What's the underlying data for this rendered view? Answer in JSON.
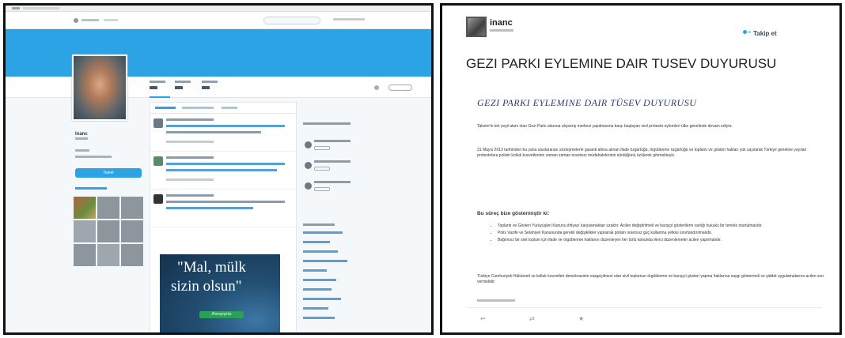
{
  "left": {
    "profile_name": "Inanc",
    "tweet_button": "Tweet",
    "promo_line1": "\"Mal, mülk",
    "promo_line2": "sizin olsun\"",
    "promo_tag": "#herşeyiniz"
  },
  "right": {
    "user_name": "inanc",
    "follow_label": "Takip et",
    "tweet_title": "GEZI PARKI EYLEMINE DAIR TUSEV DUYURUSU",
    "article_title": "GEZI PARKI EYLEMINE DAIR TÜSEV DUYURUSU",
    "paragraph1": "Taksim'in tek yeşil alanı olan Gezi Parkı alanına alışveriş merkezi yapılmasına karşı başlayan sivil protesto eylemleri ülke genelinde devam ediyor.",
    "paragraph2": "31 Mayıs 2013 tarihinden bu yana uluslararası sözleşmelerle garanti altına alınan ifade özgürlüğü, örgütlenme özgürlüğü ve toplantı ve gösteri hakları yok sayılarak Türkiye geneline yayılan protestolara polisin kolluk kuvvetlerinin zaman zaman orantısız müdahalelerinin sürdüğünü üzülerek görmekteyiz.",
    "subheading": "Bu süreç bize göstermiştir ki:",
    "list": [
      "Toplantı ve Gösteri Yürüyüşleri Kanunu ihtiyacı karşılamaktan uzaktır. Acilen değiştirilmeli ve barışçıl gösterilerin varlığı hukuku bir temele oturtulmalıdır.",
      "Polis Vazife ve Selahiyet Kanununda gerekli değişiklikler yapılarak polisin orantısız güç kullanma yetkisi sınırlandırılmalıdır.",
      "Bağımsız bir sivil toplum için ifade ve örgütlenme haklarını düzenleyen her türlü kanunda ilerici düzenlemeler acilen yapılmalıdır."
    ],
    "paragraph3": "Türkiye Cumhuriyeti Hükümeti ve kolluk kuvvetleri demokrasinin vazgeçilmezi olan sivil toplumun örgütlenme ve barışçıl gösteri yapma haklarına saygı göstermeli ve şiddet uygulamalarına acilen son vermelidir.",
    "action_reply": "↩",
    "action_retweet": "⇄",
    "action_fav": "★"
  }
}
